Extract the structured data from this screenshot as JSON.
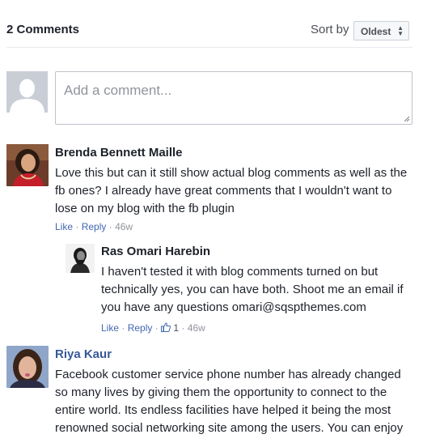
{
  "header": {
    "comment_count": "2 Comments",
    "sort_label": "Sort by",
    "sort_value": "Oldest"
  },
  "composer": {
    "placeholder": "Add a comment..."
  },
  "comments": [
    {
      "author": "Brenda Bennett Maille",
      "lines": [
        "Love this but can it still show actual blog comments as well as the",
        "fb ones? I already have great comments that I wouldn't want to",
        "lose on my blog with the fb plugin"
      ],
      "like": "Like",
      "reply": "Reply",
      "time": "46w",
      "reply_items": [
        {
          "author": "Ras Omari Harebin",
          "lines": [
            "I haven't tested it with blog comments turned on but",
            "technically yes, you can have both. Shoot me an email if",
            "you have any questions omari@sqspthemes.com"
          ],
          "like": "Like",
          "reply": "Reply",
          "reaction_count": "1",
          "time": "46w"
        }
      ]
    },
    {
      "author": "Riya Kaur",
      "lines": [
        "Facebook customer service phone number has already changed",
        "so many lives by giving them the opportunity to connect to the",
        "entire world. Its endless facilities have helped it being the most",
        "renowned social networking site among the users. You can enjoy"
      ]
    }
  ],
  "colors": {
    "link": "#4267b2",
    "name_link": "#365899",
    "meta": "#90949c",
    "text": "#1d2129"
  }
}
